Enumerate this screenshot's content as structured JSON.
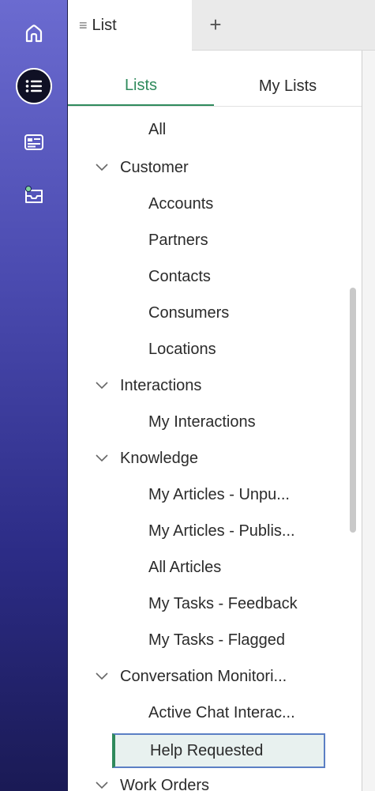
{
  "rail": {
    "items": [
      {
        "icon": "home-icon"
      },
      {
        "icon": "list-icon"
      },
      {
        "icon": "dashboard-icon"
      },
      {
        "icon": "inbox-icon"
      }
    ]
  },
  "tabstrip": {
    "tab_label": "List",
    "tab_icon": "≡",
    "add_label": "+"
  },
  "subtabs": {
    "lists": "Lists",
    "my_lists": "My Lists"
  },
  "tree": {
    "all": "All",
    "customer": {
      "label": "Customer",
      "items": [
        "Accounts",
        "Partners",
        "Contacts",
        "Consumers",
        "Locations"
      ]
    },
    "interactions": {
      "label": "Interactions",
      "items": [
        "My Interactions"
      ]
    },
    "knowledge": {
      "label": "Knowledge",
      "items": [
        "My Articles - Unpu...",
        "My Articles - Publis...",
        "All Articles",
        "My Tasks - Feedback",
        "My Tasks - Flagged"
      ]
    },
    "conversation": {
      "label": "Conversation Monitori...",
      "items": [
        "Active Chat Interac...",
        "Help Requested"
      ]
    },
    "work_orders": {
      "label": "Work Orders"
    }
  },
  "colors": {
    "accent": "#2f8a5c",
    "rail_top": "#6b6bd0",
    "rail_bottom": "#1a1a55",
    "selected_bg": "#e8f1ef",
    "selected_border": "#5b7fc4"
  }
}
